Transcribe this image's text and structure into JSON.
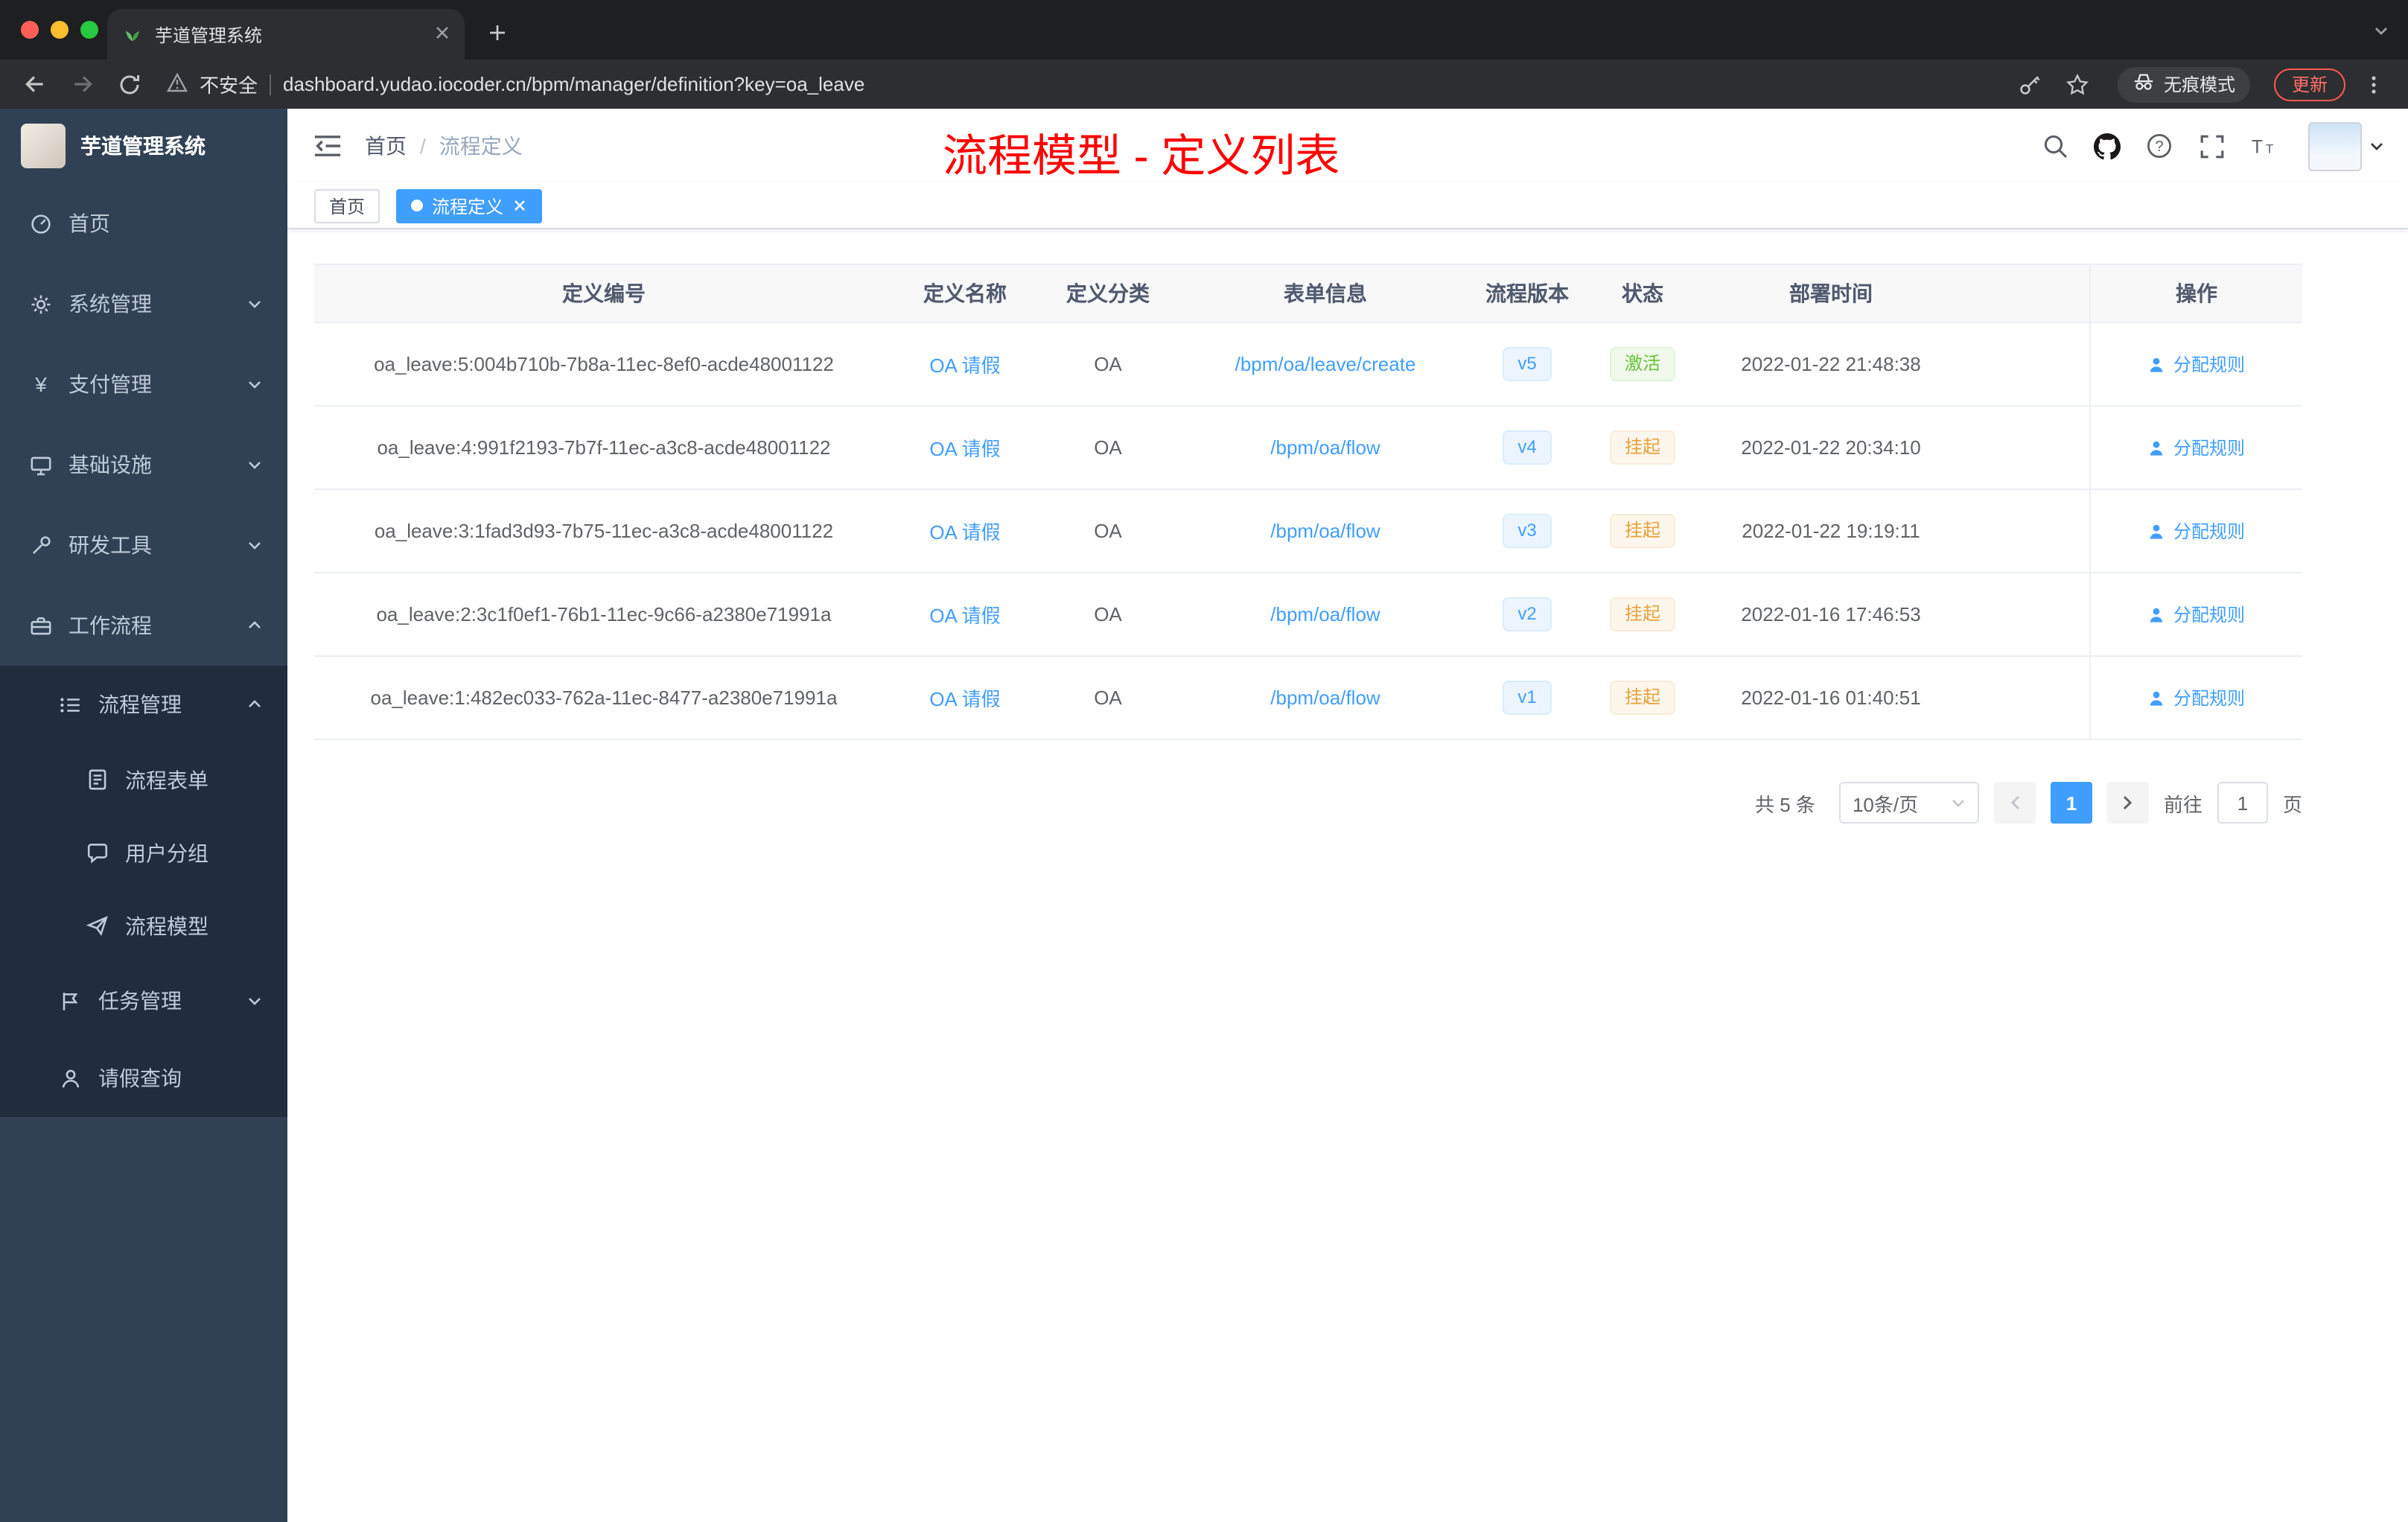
{
  "browser": {
    "tab_title": "芋道管理系统",
    "security": "不安全",
    "url": "dashboard.yudao.iocoder.cn/bpm/manager/definition?key=oa_leave",
    "incognito": "无痕模式",
    "update": "更新"
  },
  "sidebar": {
    "logo_title": "芋道管理系统",
    "items": [
      {
        "label": "首页"
      },
      {
        "label": "系统管理"
      },
      {
        "label": "支付管理"
      },
      {
        "label": "基础设施"
      },
      {
        "label": "研发工具"
      },
      {
        "label": "工作流程"
      },
      {
        "label": "流程管理"
      },
      {
        "label": "流程表单"
      },
      {
        "label": "用户分组"
      },
      {
        "label": "流程模型"
      },
      {
        "label": "任务管理"
      },
      {
        "label": "请假查询"
      }
    ]
  },
  "header": {
    "breadcrumb_home": "首页",
    "breadcrumb_separator": "/",
    "breadcrumb_current": "流程定义",
    "annotation": "流程模型 - 定义列表"
  },
  "tags": [
    {
      "label": "首页"
    },
    {
      "label": "流程定义"
    }
  ],
  "table": {
    "columns": [
      "定义编号",
      "定义名称",
      "定义分类",
      "表单信息",
      "流程版本",
      "状态",
      "部署时间",
      "操作"
    ],
    "rows": [
      {
        "id": "oa_leave:5:004b710b-7b8a-11ec-8ef0-acde48001122",
        "name": "OA 请假",
        "category": "OA",
        "form": "/bpm/oa/leave/create",
        "version": "v5",
        "status": "激活",
        "time": "2022-01-22 21:48:38",
        "action": "分配规则"
      },
      {
        "id": "oa_leave:4:991f2193-7b7f-11ec-a3c8-acde48001122",
        "name": "OA 请假",
        "category": "OA",
        "form": "/bpm/oa/flow",
        "version": "v4",
        "status": "挂起",
        "time": "2022-01-22 20:34:10",
        "action": "分配规则"
      },
      {
        "id": "oa_leave:3:1fad3d93-7b75-11ec-a3c8-acde48001122",
        "name": "OA 请假",
        "category": "OA",
        "form": "/bpm/oa/flow",
        "version": "v3",
        "status": "挂起",
        "time": "2022-01-22 19:19:11",
        "action": "分配规则"
      },
      {
        "id": "oa_leave:2:3c1f0ef1-76b1-11ec-9c66-a2380e71991a",
        "name": "OA 请假",
        "category": "OA",
        "form": "/bpm/oa/flow",
        "version": "v2",
        "status": "挂起",
        "time": "2022-01-16 17:46:53",
        "action": "分配规则"
      },
      {
        "id": "oa_leave:1:482ec033-762a-11ec-8477-a2380e71991a",
        "name": "OA 请假",
        "category": "OA",
        "form": "/bpm/oa/flow",
        "version": "v1",
        "status": "挂起",
        "time": "2022-01-16 01:40:51",
        "action": "分配规则"
      }
    ]
  },
  "pagination": {
    "total": "共 5 条",
    "page_size": "10条/页",
    "current_page": "1",
    "goto_label": "前往",
    "goto_value": "1",
    "page_unit": "页"
  },
  "colors": {
    "accent": "#409eff",
    "success": "#67c23a",
    "warning": "#e6a23c",
    "annotation": "#ff0000",
    "sidebar_bg": "#304156",
    "submenu_bg": "#1f2d3d"
  }
}
